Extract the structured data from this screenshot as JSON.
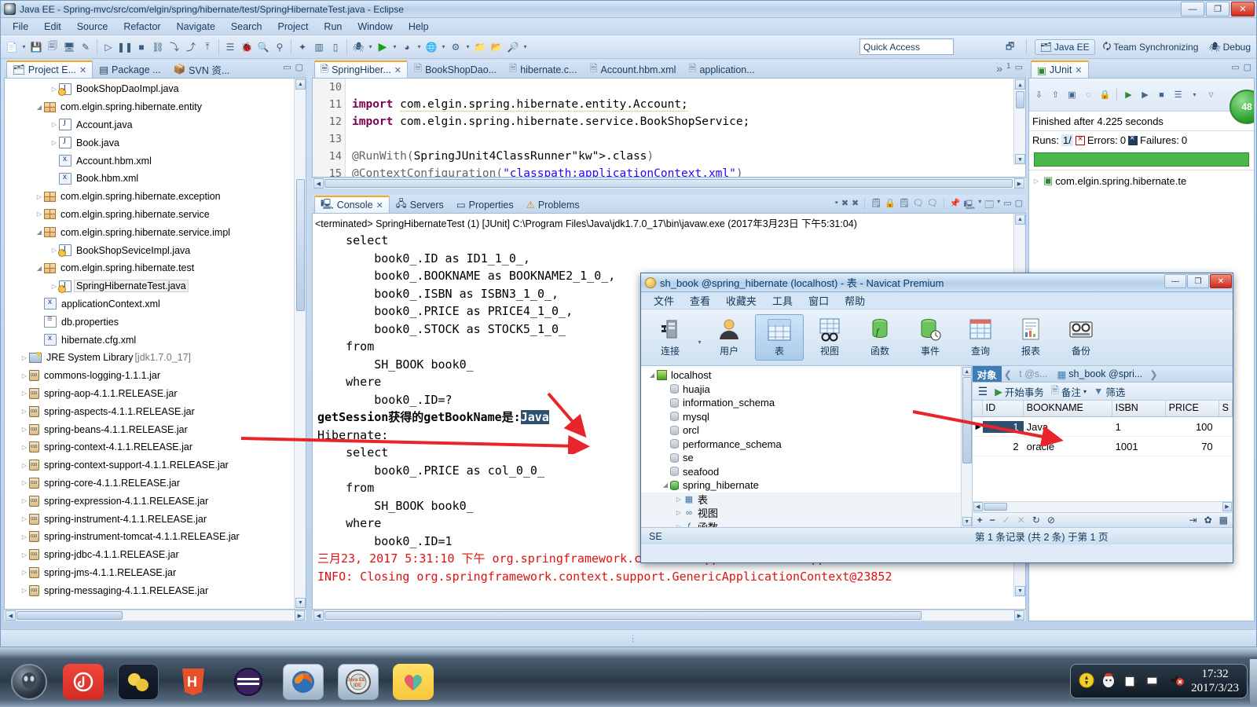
{
  "eclipse": {
    "title": "Java EE - Spring-mvc/src/com/elgin/spring/hibernate/test/SpringHibernateTest.java - Eclipse",
    "window_buttons": {
      "minimize": "—",
      "maximize": "❐",
      "close": "✕"
    },
    "menu": [
      "File",
      "Edit",
      "Source",
      "Refactor",
      "Navigate",
      "Search",
      "Project",
      "Run",
      "Window",
      "Help"
    ],
    "quick_access": "Quick Access",
    "perspectives": [
      {
        "label": "Java EE",
        "active": true
      },
      {
        "label": "Team Synchronizing",
        "active": false
      },
      {
        "label": "Debug",
        "active": false
      }
    ],
    "status_bar": ""
  },
  "project_explorer": {
    "tabs": [
      {
        "label": "Project E...",
        "icon": "project-explorer-icon",
        "selected": true,
        "closable": true
      },
      {
        "label": "Package ...",
        "icon": "package-explorer-icon",
        "selected": false,
        "closable": false
      },
      {
        "label": "SVN 资...",
        "icon": "svn-icon",
        "selected": false,
        "closable": false
      }
    ],
    "items": [
      {
        "label": "BookShopDaoImpl.java",
        "indent": 3,
        "arrow": "▷",
        "icon": "java-class-icon"
      },
      {
        "label": "com.elgin.spring.hibernate.entity",
        "indent": 2,
        "arrow": "◢",
        "icon": "package-icon"
      },
      {
        "label": "Account.java",
        "indent": 3,
        "arrow": "▷",
        "icon": "java-file-icon"
      },
      {
        "label": "Book.java",
        "indent": 3,
        "arrow": "▷",
        "icon": "java-file-icon"
      },
      {
        "label": "Account.hbm.xml",
        "indent": 3,
        "arrow": "",
        "icon": "xml-file-icon"
      },
      {
        "label": "Book.hbm.xml",
        "indent": 3,
        "arrow": "",
        "icon": "xml-file-icon"
      },
      {
        "label": "com.elgin.spring.hibernate.exception",
        "indent": 2,
        "arrow": "▷",
        "icon": "package-icon"
      },
      {
        "label": "com.elgin.spring.hibernate.service",
        "indent": 2,
        "arrow": "▷",
        "icon": "package-icon"
      },
      {
        "label": "com.elgin.spring.hibernate.service.impl",
        "indent": 2,
        "arrow": "◢",
        "icon": "package-icon"
      },
      {
        "label": "BookShopSeviceImpl.java",
        "indent": 3,
        "arrow": "▷",
        "icon": "java-class-icon"
      },
      {
        "label": "com.elgin.spring.hibernate.test",
        "indent": 2,
        "arrow": "◢",
        "icon": "package-icon"
      },
      {
        "label": "SpringHibernateTest.java",
        "indent": 3,
        "arrow": "▷",
        "icon": "java-class-icon",
        "selected": true
      },
      {
        "label": "applicationContext.xml",
        "indent": 2,
        "arrow": "",
        "icon": "xml-file-icon"
      },
      {
        "label": "db.properties",
        "indent": 2,
        "arrow": "",
        "icon": "properties-file-icon"
      },
      {
        "label": "hibernate.cfg.xml",
        "indent": 2,
        "arrow": "",
        "icon": "xml-file-icon"
      },
      {
        "label": "JRE System Library",
        "suffix": "[jdk1.7.0_17]",
        "indent": 1,
        "arrow": "▷",
        "icon": "jre-library-icon"
      },
      {
        "label": "commons-logging-1.1.1.jar",
        "indent": 1,
        "arrow": "▷",
        "icon": "jar-icon"
      },
      {
        "label": "spring-aop-4.1.1.RELEASE.jar",
        "indent": 1,
        "arrow": "▷",
        "icon": "jar-icon"
      },
      {
        "label": "spring-aspects-4.1.1.RELEASE.jar",
        "indent": 1,
        "arrow": "▷",
        "icon": "jar-icon"
      },
      {
        "label": "spring-beans-4.1.1.RELEASE.jar",
        "indent": 1,
        "arrow": "▷",
        "icon": "jar-icon"
      },
      {
        "label": "spring-context-4.1.1.RELEASE.jar",
        "indent": 1,
        "arrow": "▷",
        "icon": "jar-icon"
      },
      {
        "label": "spring-context-support-4.1.1.RELEASE.jar",
        "indent": 1,
        "arrow": "▷",
        "icon": "jar-icon"
      },
      {
        "label": "spring-core-4.1.1.RELEASE.jar",
        "indent": 1,
        "arrow": "▷",
        "icon": "jar-icon"
      },
      {
        "label": "spring-expression-4.1.1.RELEASE.jar",
        "indent": 1,
        "arrow": "▷",
        "icon": "jar-icon"
      },
      {
        "label": "spring-instrument-4.1.1.RELEASE.jar",
        "indent": 1,
        "arrow": "▷",
        "icon": "jar-icon"
      },
      {
        "label": "spring-instrument-tomcat-4.1.1.RELEASE.jar",
        "indent": 1,
        "arrow": "▷",
        "icon": "jar-icon"
      },
      {
        "label": "spring-jdbc-4.1.1.RELEASE.jar",
        "indent": 1,
        "arrow": "▷",
        "icon": "jar-icon"
      },
      {
        "label": "spring-jms-4.1.1.RELEASE.jar",
        "indent": 1,
        "arrow": "▷",
        "icon": "jar-icon"
      },
      {
        "label": "spring-messaging-4.1.1.RELEASE.jar",
        "indent": 1,
        "arrow": "▷",
        "icon": "jar-icon"
      }
    ]
  },
  "editor": {
    "tabs": [
      {
        "label": "SpringHiber...",
        "selected": true,
        "closable": true,
        "icon": "java-class-icon"
      },
      {
        "label": "BookShopDao...",
        "selected": false,
        "closable": false,
        "icon": "java-class-icon"
      },
      {
        "label": "hibernate.c...",
        "selected": false,
        "closable": false,
        "icon": "xml-file-icon"
      },
      {
        "label": "Account.hbm.xml",
        "selected": false,
        "closable": false,
        "icon": "xml-file-icon"
      },
      {
        "label": "application...",
        "selected": false,
        "closable": false,
        "icon": "xml-file-icon"
      }
    ],
    "overflow_label": "»",
    "overflow_count": "1",
    "lines": [
      {
        "no": "10",
        "text": ""
      },
      {
        "no": "11",
        "text": "import com.elgin.spring.hibernate.entity.Account;",
        "kind": "import",
        "warn": true
      },
      {
        "no": "12",
        "text": "import com.elgin.spring.hibernate.service.BookShopService;",
        "kind": "import"
      },
      {
        "no": "13",
        "text": ""
      },
      {
        "no": "14",
        "text": "@RunWith(SpringJUnit4ClassRunner.class)",
        "kind": "annotation"
      },
      {
        "no": "15",
        "text": "@ContextConfiguration(\"classpath:applicationContext.xml\")",
        "kind": "annotation"
      }
    ]
  },
  "console": {
    "tabs": [
      {
        "label": "Console",
        "selected": true,
        "closable": true,
        "icon": "console-icon"
      },
      {
        "label": "Servers",
        "selected": false,
        "closable": false,
        "icon": "servers-icon"
      },
      {
        "label": "Properties",
        "selected": false,
        "closable": false,
        "icon": "properties-icon"
      },
      {
        "label": "Problems",
        "selected": false,
        "closable": false,
        "icon": "problems-icon"
      }
    ],
    "header": "<terminated> SpringHibernateTest (1) [JUnit] C:\\Program Files\\Java\\jdk1.7.0_17\\bin\\javaw.exe (2017年3月23日 下午5:31:04)",
    "lines": [
      {
        "text": "    select",
        "color": "black"
      },
      {
        "text": "        book0_.ID as ID1_1_0_,",
        "color": "black"
      },
      {
        "text": "        book0_.BOOKNAME as BOOKNAME2_1_0_,",
        "color": "black"
      },
      {
        "text": "        book0_.ISBN as ISBN3_1_0_,",
        "color": "black"
      },
      {
        "text": "        book0_.PRICE as PRICE4_1_0_,",
        "color": "black"
      },
      {
        "text": "        book0_.STOCK as STOCK5_1_0_",
        "color": "black"
      },
      {
        "text": "    from",
        "color": "black"
      },
      {
        "text": "        SH_BOOK book0_",
        "color": "black"
      },
      {
        "text": "    where",
        "color": "black"
      },
      {
        "text": "        book0_.ID=?",
        "color": "black"
      },
      {
        "text": "getSession获得的getBookName是:",
        "highlight": "Java",
        "color": "black",
        "bold": true
      },
      {
        "text": "Hibernate:",
        "color": "black"
      },
      {
        "text": "    select",
        "color": "black"
      },
      {
        "text": "        book0_.PRICE as col_0_0_",
        "color": "black"
      },
      {
        "text": "    from",
        "color": "black"
      },
      {
        "text": "        SH_BOOK book0_",
        "color": "black"
      },
      {
        "text": "    where",
        "color": "black"
      },
      {
        "text": "        book0_.ID=1",
        "color": "black"
      },
      {
        "text": "三月23, 2017 5:31:10 下午 org.springframework.context.support.AbstractApplicationCon",
        "color": "red"
      },
      {
        "text": "INFO: Closing org.springframework.context.support.GenericApplicationContext@23852",
        "color": "red"
      }
    ]
  },
  "junit": {
    "tab_label": "JUnit",
    "status": "Finished after 4.225 seconds",
    "runs_label": "Runs:",
    "runs_value": "1/",
    "errors_label": "Errors:",
    "errors_value": "0",
    "failures_label": "Failures:",
    "failures_value": "0",
    "progress_color": "#4bb74b",
    "badge": "48",
    "tree_item": "com.elgin.spring.hibernate.te"
  },
  "navicat": {
    "title": "sh_book @spring_hibernate (localhost) - 表 - Navicat Premium",
    "window_buttons": {
      "minimize": "—",
      "maximize": "❐",
      "close": "✕"
    },
    "menu": [
      "文件",
      "查看",
      "收藏夹",
      "工具",
      "窗口",
      "帮助"
    ],
    "toolbar": [
      {
        "label": "连接",
        "icon": "connection-icon",
        "selected": false,
        "dropdown": true
      },
      {
        "label": "用户",
        "icon": "user-icon",
        "selected": false
      },
      {
        "label": "表",
        "icon": "table-icon",
        "selected": true
      },
      {
        "label": "视图",
        "icon": "view-icon",
        "selected": false
      },
      {
        "label": "函数",
        "icon": "function-icon",
        "selected": false
      },
      {
        "label": "事件",
        "icon": "event-icon",
        "selected": false
      },
      {
        "label": "查询",
        "icon": "query-icon",
        "selected": false
      },
      {
        "label": "报表",
        "icon": "report-icon",
        "selected": false
      },
      {
        "label": "备份",
        "icon": "backup-icon",
        "selected": false
      }
    ],
    "tree": [
      {
        "label": "localhost",
        "indent": 0,
        "arrow": "◢",
        "icon": "host-icon"
      },
      {
        "label": "huajia",
        "indent": 1,
        "arrow": "",
        "icon": "database-icon"
      },
      {
        "label": "information_schema",
        "indent": 1,
        "arrow": "",
        "icon": "database-icon"
      },
      {
        "label": "mysql",
        "indent": 1,
        "arrow": "",
        "icon": "database-icon"
      },
      {
        "label": "orcl",
        "indent": 1,
        "arrow": "",
        "icon": "database-icon"
      },
      {
        "label": "performance_schema",
        "indent": 1,
        "arrow": "",
        "icon": "database-icon"
      },
      {
        "label": "se",
        "indent": 1,
        "arrow": "",
        "icon": "database-icon"
      },
      {
        "label": "seafood",
        "indent": 1,
        "arrow": "",
        "icon": "database-icon"
      },
      {
        "label": "spring_hibernate",
        "indent": 1,
        "arrow": "◢",
        "icon": "database-open-icon"
      },
      {
        "label": "表",
        "indent": 2,
        "arrow": "▷",
        "icon": "tables-folder-icon"
      },
      {
        "label": "视图",
        "indent": 2,
        "arrow": "▷",
        "icon": "views-folder-icon"
      },
      {
        "label": "函数",
        "indent": 2,
        "arrow": "▷",
        "icon": "functions-folder-icon"
      }
    ],
    "tabs": [
      {
        "label": "对象",
        "selected": true
      },
      {
        "label": "t @s...",
        "selected": false,
        "icon": "prev-arrow-icon"
      },
      {
        "label": "sh_book @spri...",
        "selected": false,
        "icon": "table-tab-icon"
      },
      {
        "label": "",
        "selected": false,
        "icon": "next-arrow-icon"
      }
    ],
    "grid_toolbar": [
      {
        "label": "开始事务",
        "icon": "begin-transaction-icon"
      },
      {
        "label": "备注",
        "icon": "note-icon",
        "dropdown": true
      },
      {
        "label": "筛选",
        "icon": "filter-icon"
      }
    ],
    "grid": {
      "columns": [
        "ID",
        "BOOKNAME",
        "ISBN",
        "PRICE",
        "S"
      ],
      "rows": [
        {
          "cells": [
            "1",
            "Java",
            "1",
            "100",
            ""
          ],
          "selected": true,
          "marker": "▶"
        },
        {
          "cells": [
            "2",
            "oracle",
            "1001",
            "70",
            ""
          ],
          "selected": false,
          "marker": ""
        }
      ]
    },
    "grid_bottom_buttons": [
      "+",
      "−",
      "✓",
      "✕",
      "↻",
      "⊘",
      "⇥",
      "✿"
    ],
    "status_left": "SE",
    "status_right": "第 1 条记录 (共 2 条) 于第 1 页"
  },
  "taskbar": {
    "items": [
      {
        "name": "start-orb",
        "label": ""
      },
      {
        "name": "netease-music-icon",
        "label": ""
      },
      {
        "name": "folder-app-icon",
        "label": ""
      },
      {
        "name": "html5-icon",
        "label": ""
      },
      {
        "name": "purple-app-icon",
        "label": ""
      },
      {
        "name": "firefox-icon",
        "label": ""
      },
      {
        "name": "eclipse-javaee-icon",
        "label": "Java EE IDE"
      },
      {
        "name": "yellow-heart-icon",
        "label": ""
      }
    ],
    "tray_icons": [
      "action-center-icon",
      "qq-icon",
      "usb-icon",
      "network-icon",
      "volume-muted-icon"
    ],
    "clock_time": "17:32",
    "clock_date": "2017/3/23"
  }
}
